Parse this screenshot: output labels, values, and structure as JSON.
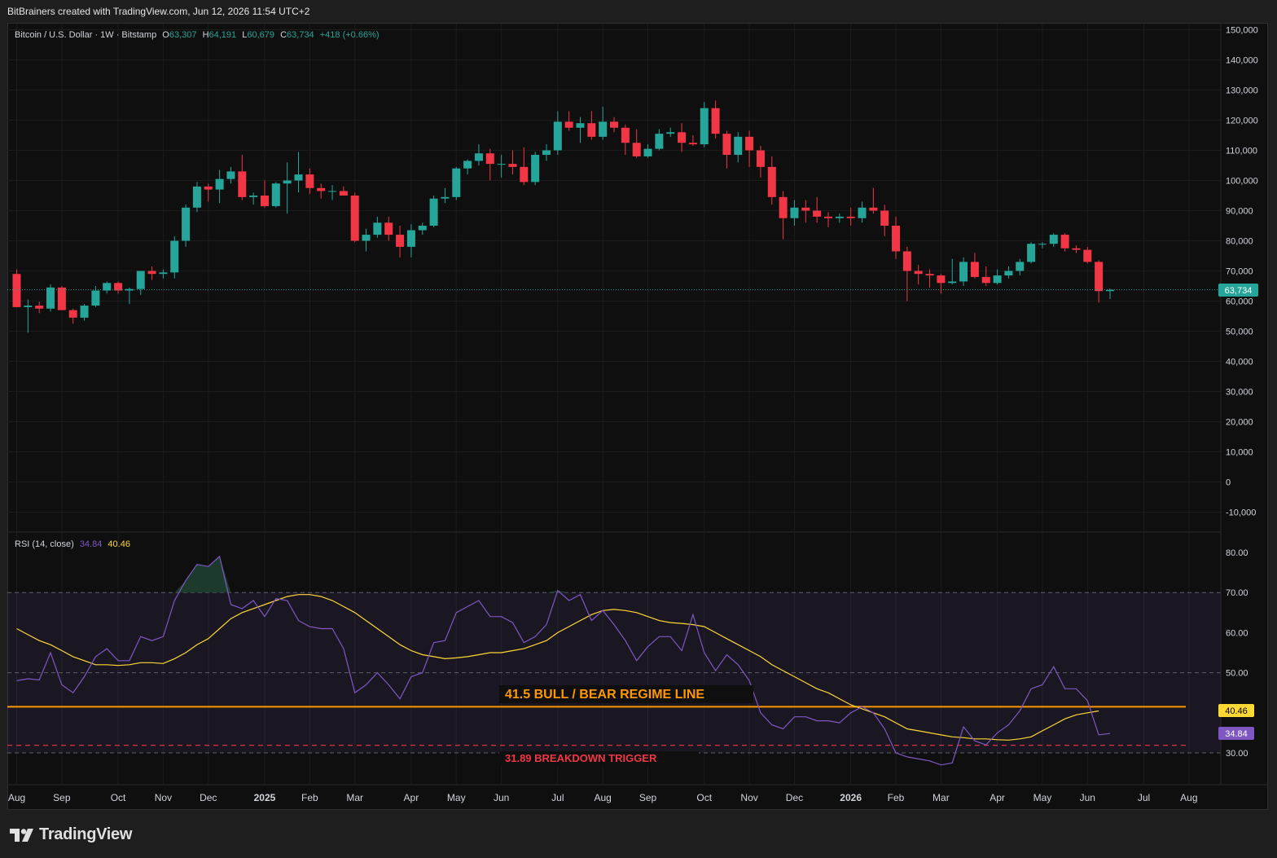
{
  "header": {
    "attribution": "BitBrainers created with TradingView.com, Jun 12, 2026 11:54 UTC+2"
  },
  "legend": {
    "symbol": "Bitcoin / U.S. Dollar · 1W · Bitstamp",
    "open_label": "O",
    "open": "63,307",
    "high_label": "H",
    "high": "64,191",
    "low_label": "L",
    "low": "60,679",
    "close_label": "C",
    "close": "63,734",
    "change": "+418 (+0.66%)"
  },
  "rsi_legend": {
    "label": "RSI (14, close)",
    "rsi_value": "34.84",
    "ma_value": "40.46"
  },
  "price_tag": "63,734",
  "rsi_tag": "34.84",
  "rsi_ma_tag": "40.46",
  "annotations": {
    "bull_bear": "41.5  BULL / BEAR REGIME LINE",
    "breakdown": "31.89  BREAKDOWN TRIGGER"
  },
  "footer": {
    "brand": "TradingView"
  },
  "colors": {
    "up": "#26a69a",
    "down": "#f23645",
    "rsi_line": "#7e57c2",
    "rsi_ma": "#fdd835",
    "regime_line": "#ff9800",
    "breakdown_line": "#f23645",
    "background": "#0f0f0f"
  },
  "chart_data": [
    {
      "type": "candlestick",
      "title": "Bitcoin / U.S. Dollar · 1W · Bitstamp",
      "y_ticks": [
        "150,000",
        "140,000",
        "130,000",
        "120,000",
        "110,000",
        "100,000",
        "90,000",
        "80,000",
        "70,000",
        "60,000",
        "50,000",
        "40,000",
        "30,000",
        "20,000",
        "10,000",
        "0",
        "-10,000"
      ],
      "y_tick_values": [
        150000,
        140000,
        130000,
        120000,
        110000,
        100000,
        90000,
        80000,
        70000,
        60000,
        50000,
        40000,
        30000,
        20000,
        10000,
        0,
        -10000
      ],
      "x_ticks": [
        "Aug",
        "Sep",
        "Oct",
        "Nov",
        "Dec",
        "2025",
        "Feb",
        "Mar",
        "Apr",
        "May",
        "Jun",
        "Jul",
        "Aug",
        "Sep",
        "Oct",
        "Nov",
        "Dec",
        "2026",
        "Feb",
        "Mar",
        "Apr",
        "May",
        "Jun",
        "Jul",
        "Aug"
      ],
      "x_tick_week_index": [
        0,
        4,
        9,
        13,
        17,
        22,
        26,
        30,
        35,
        39,
        43,
        48,
        52,
        56,
        61,
        65,
        69,
        74,
        78,
        82,
        87,
        91,
        95,
        100,
        104
      ],
      "last_price": 63734,
      "candles": [
        [
          69000,
          70500,
          60000,
          58000
        ],
        [
          58000,
          60500,
          49500,
          58500
        ],
        [
          58500,
          59800,
          56000,
          57500
        ],
        [
          57500,
          65500,
          56500,
          64500
        ],
        [
          64500,
          65000,
          57000,
          57000
        ],
        [
          57000,
          57500,
          52500,
          54500
        ],
        [
          54500,
          59000,
          53500,
          58500
        ],
        [
          58500,
          65000,
          58000,
          63500
        ],
        [
          63500,
          66500,
          62500,
          66000
        ],
        [
          66000,
          66500,
          62500,
          63500
        ],
        [
          63500,
          64500,
          59000,
          64000
        ],
        [
          64000,
          70000,
          62000,
          70000
        ],
        [
          70000,
          71500,
          67000,
          69000
        ],
        [
          69000,
          70500,
          67500,
          69500
        ],
        [
          69500,
          81500,
          67500,
          80000
        ],
        [
          80000,
          92000,
          78000,
          91000
        ],
        [
          91000,
          99500,
          89500,
          98000
        ],
        [
          98000,
          99000,
          93000,
          97000
        ],
        [
          97000,
          103500,
          92500,
          100500
        ],
        [
          100500,
          104500,
          99000,
          103000
        ],
        [
          103000,
          108500,
          93500,
          94500
        ],
        [
          94500,
          96000,
          92000,
          95000
        ],
        [
          95000,
          100000,
          91000,
          91500
        ],
        [
          91500,
          99500,
          91000,
          99000
        ],
        [
          99000,
          106000,
          89000,
          100000
        ],
        [
          100000,
          109500,
          96000,
          102000
        ],
        [
          102000,
          104000,
          95500,
          97500
        ],
        [
          97500,
          99000,
          94000,
          96500
        ],
        [
          96500,
          98500,
          93500,
          96500
        ],
        [
          96500,
          98000,
          95000,
          95000
        ],
        [
          95000,
          96000,
          79500,
          80000
        ],
        [
          80000,
          84000,
          76500,
          82000
        ],
        [
          82000,
          88000,
          81000,
          86000
        ],
        [
          86000,
          88000,
          80000,
          82000
        ],
        [
          82000,
          85000,
          74500,
          78000
        ],
        [
          78000,
          85500,
          74500,
          83500
        ],
        [
          83500,
          86000,
          82000,
          85000
        ],
        [
          85000,
          95000,
          84500,
          94000
        ],
        [
          94000,
          97500,
          92500,
          94500
        ],
        [
          94500,
          104500,
          93500,
          104000
        ],
        [
          104000,
          107000,
          102000,
          106500
        ],
        [
          106500,
          112000,
          105000,
          109000
        ],
        [
          109000,
          110500,
          100000,
          105500
        ],
        [
          105500,
          108500,
          101000,
          105500
        ],
        [
          105500,
          110000,
          102000,
          104500
        ],
        [
          104500,
          111000,
          98500,
          99500
        ],
        [
          99500,
          109500,
          98500,
          108500
        ],
        [
          108500,
          112000,
          106500,
          110000
        ],
        [
          110000,
          123000,
          108500,
          119500
        ],
        [
          119500,
          123000,
          116500,
          117500
        ],
        [
          117500,
          121000,
          112500,
          119000
        ],
        [
          119000,
          123000,
          113500,
          114500
        ],
        [
          114500,
          124500,
          113500,
          119500
        ],
        [
          119500,
          121000,
          116000,
          117500
        ],
        [
          117500,
          118500,
          108500,
          112500
        ],
        [
          112500,
          117000,
          107500,
          108000
        ],
        [
          108000,
          112000,
          107500,
          110500
        ],
        [
          110500,
          117000,
          110000,
          115500
        ],
        [
          115500,
          117500,
          114500,
          116000
        ],
        [
          116000,
          119000,
          109500,
          112500
        ],
        [
          112500,
          115000,
          111500,
          112000
        ],
        [
          112000,
          126000,
          111000,
          124000
        ],
        [
          124000,
          126500,
          114000,
          115500
        ],
        [
          115500,
          116500,
          104000,
          108500
        ],
        [
          108500,
          116000,
          106000,
          114500
        ],
        [
          114500,
          116500,
          104500,
          110000
        ],
        [
          110000,
          111500,
          101000,
          104500
        ],
        [
          104500,
          108000,
          92000,
          94500
        ],
        [
          94500,
          96500,
          80500,
          87500
        ],
        [
          87500,
          93500,
          85000,
          91000
        ],
        [
          91000,
          93500,
          86000,
          90000
        ],
        [
          90000,
          94500,
          86000,
          88000
        ],
        [
          88000,
          89500,
          84500,
          87500
        ],
        [
          87500,
          89000,
          86000,
          88000
        ],
        [
          88000,
          91000,
          85000,
          87500
        ],
        [
          87500,
          93000,
          86000,
          91000
        ],
        [
          91000,
          97500,
          89000,
          90000
        ],
        [
          90000,
          92000,
          81500,
          85000
        ],
        [
          85000,
          88000,
          74000,
          76500
        ],
        [
          76500,
          78000,
          60000,
          70000
        ],
        [
          70000,
          72000,
          65500,
          69000
        ],
        [
          69000,
          70500,
          64500,
          68500
        ],
        [
          68500,
          69000,
          62500,
          66000
        ],
        [
          66000,
          74000,
          65500,
          66500
        ],
        [
          66500,
          74500,
          65000,
          73000
        ],
        [
          73000,
          76000,
          67500,
          68000
        ],
        [
          68000,
          71500,
          65000,
          66000
        ],
        [
          66000,
          70500,
          65500,
          68500
        ],
        [
          68500,
          71500,
          67500,
          70000
        ],
        [
          70000,
          74000,
          68500,
          73000
        ],
        [
          73000,
          79500,
          72500,
          79000
        ],
        [
          79000,
          79500,
          77500,
          79000
        ],
        [
          79000,
          82500,
          78000,
          82000
        ],
        [
          82000,
          82500,
          76500,
          77500
        ],
        [
          77500,
          78500,
          76000,
          77000
        ],
        [
          77000,
          78000,
          72500,
          73000
        ],
        [
          73000,
          73500,
          59500,
          63307
        ],
        [
          63307,
          64191,
          60679,
          63734
        ]
      ]
    },
    {
      "type": "line",
      "title": "RSI (14, close)",
      "y_ticks": [
        "80.00",
        "70.00",
        "60.00",
        "50.00",
        "30.00"
      ],
      "y_tick_values": [
        80,
        70,
        60,
        50,
        30
      ],
      "levels": [
        70,
        50,
        30
      ],
      "series": [
        {
          "name": "RSI",
          "values": [
            48,
            48.5,
            48.2,
            55,
            47,
            45,
            49,
            54,
            56,
            53,
            53,
            59,
            58,
            59,
            68,
            73,
            77,
            76.5,
            79,
            67,
            66,
            68,
            64,
            68.5,
            68,
            63,
            61.5,
            61,
            61,
            56,
            45,
            47,
            50,
            47,
            43.5,
            49,
            50,
            57.5,
            58,
            65,
            66.5,
            68,
            64,
            64,
            62.5,
            57.5,
            59,
            62,
            70.5,
            68,
            69.5,
            63,
            65.5,
            62,
            58,
            53,
            56.5,
            59,
            59,
            55.5,
            64.5,
            55,
            50.5,
            54.5,
            52,
            48,
            40,
            37,
            36,
            39,
            39,
            38,
            38,
            37.5,
            40,
            41.5,
            40,
            36,
            30,
            29,
            28.5,
            28,
            27,
            27.5,
            36.5,
            33,
            32,
            35,
            37,
            40.5,
            46,
            47,
            51.5,
            46,
            46,
            43,
            34.5,
            34.84
          ]
        },
        {
          "name": "RSI-based MA",
          "values": [
            61,
            59.5,
            58,
            57,
            55.5,
            54,
            53,
            52,
            52,
            51.8,
            52,
            52.5,
            52.5,
            52.3,
            53.5,
            55,
            57,
            58.5,
            61,
            63.5,
            65,
            66,
            67,
            68,
            69,
            69.5,
            69.5,
            69,
            68,
            66.5,
            65,
            63,
            61,
            59,
            57,
            55.5,
            54.5,
            54,
            53.5,
            53.7,
            54,
            54.5,
            55,
            55,
            55.5,
            56,
            57,
            58,
            60,
            61.5,
            63,
            64.5,
            65.5,
            65.8,
            65.5,
            65,
            64,
            63,
            62.5,
            62.3,
            62,
            61.5,
            60,
            58.5,
            57,
            55.5,
            54,
            52,
            50.5,
            49,
            47.5,
            46,
            45,
            43.5,
            42,
            41,
            40,
            39,
            37.5,
            36,
            35.5,
            35,
            34.5,
            34,
            33.8,
            33.5,
            33.5,
            33.3,
            33.2,
            33.5,
            34,
            35.5,
            37,
            38.5,
            39.5,
            40,
            40.46
          ]
        }
      ]
    }
  ]
}
